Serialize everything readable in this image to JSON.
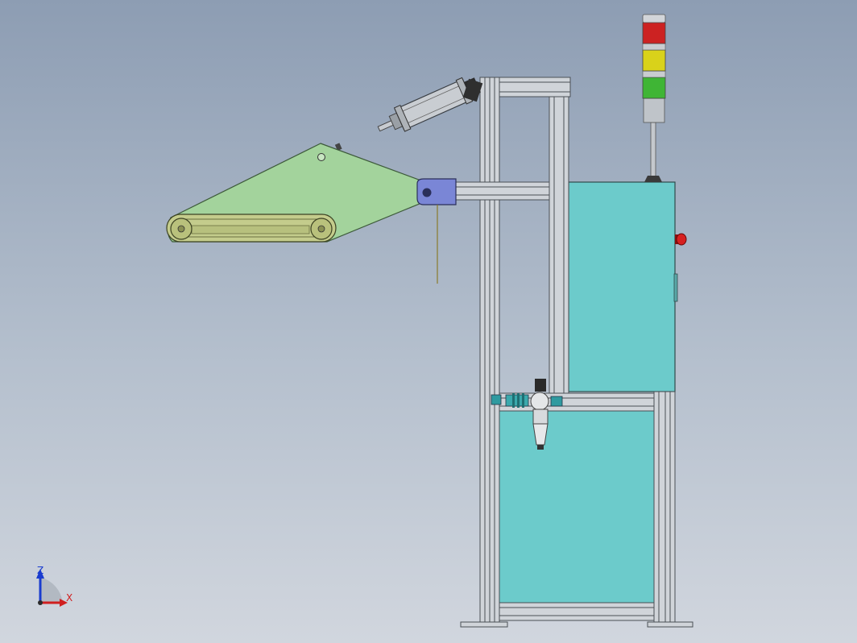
{
  "triad": {
    "z_label": "Z",
    "x_label": "X"
  },
  "colors": {
    "frame": "#d0d4d9",
    "frame_edge": "#4a4f55",
    "panel": "#6ccbcb",
    "arm": "#a3d39c",
    "belt": "#c4cc8c",
    "pivot": "#7a86d6",
    "tower_red": "#cc2222",
    "tower_yellow": "#d9d21a",
    "tower_green": "#3fb535",
    "axis_z": "#1a3ccf",
    "axis_x": "#d01f1f"
  },
  "icons": {
    "signal_tower": "signal-tower-icon",
    "emergency_stop": "emergency-stop-icon",
    "air_filter": "air-filter-regulator-icon",
    "triad": "axis-triad-icon"
  }
}
